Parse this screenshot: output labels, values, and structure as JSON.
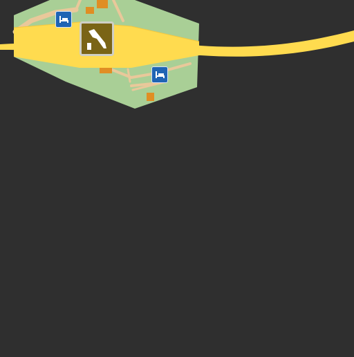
{
  "map": {
    "background_color": "#2f2f2f",
    "land_color": "#a9cf96",
    "road_color": "#ffdb4f",
    "building_color": "#e08e24",
    "minor_road_color": "#e9c89a",
    "pois": [
      {
        "name": "hotel",
        "icon": "bed-icon",
        "color": "#1f64b4"
      },
      {
        "name": "hotel",
        "icon": "bed-icon",
        "color": "#1f64b4"
      },
      {
        "name": "landmark",
        "icon": "landmark-icon",
        "color": "#7a6416"
      }
    ]
  }
}
